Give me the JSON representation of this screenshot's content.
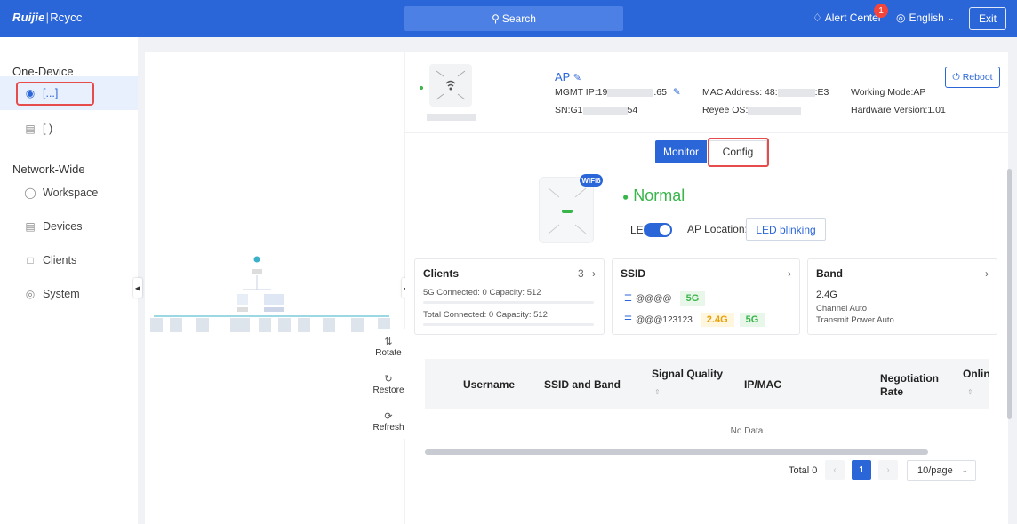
{
  "header": {
    "logo_brand": "Ruijie",
    "logo_sub": "Rcycc",
    "search_label": "Search",
    "alert_label": "Alert Center",
    "alert_count": "1",
    "language": "English",
    "exit_label": "Exit"
  },
  "sidebar": {
    "one_device_label": "One-Device",
    "device_item_1": "[...]",
    "device_item_2": "[ )",
    "network_wide_label": "Network-Wide",
    "items": [
      {
        "label": "Workspace",
        "icon": "workspace-icon"
      },
      {
        "label": "Devices",
        "icon": "devices-icon"
      },
      {
        "label": "Clients",
        "icon": "clients-icon"
      },
      {
        "label": "System",
        "icon": "system-icon"
      }
    ]
  },
  "topology_controls": {
    "rotate": "Rotate",
    "restore": "Restore",
    "refresh": "Refresh"
  },
  "device": {
    "title": "AP",
    "mgmt_ip_label": "MGMT IP:19",
    "mgmt_ip_suffix": ".65",
    "sn_label": "SN:G1",
    "sn_suffix": "54",
    "mac_label": "MAC Address: 48:",
    "mac_suffix": ":E3",
    "os_label": "Reyee OS:",
    "working_mode": "Working Mode:AP",
    "hardware_version": "Hardware Version:1.01",
    "reboot_label": "Reboot"
  },
  "tabs": {
    "monitor": "Monitor",
    "config": "Config"
  },
  "status": {
    "wifi_badge": "WiFi6",
    "state": "Normal",
    "led_label": "LED:",
    "led_on": true,
    "ap_location_label": "AP Location:",
    "led_blinking_button": "LED blinking"
  },
  "cards": {
    "clients": {
      "title": "Clients",
      "count": "3",
      "line1": "5G Connected: 0  Capacity: 512",
      "line2": "Total Connected: 0  Capacity: 512"
    },
    "ssid": {
      "title": "SSID",
      "rows": [
        {
          "name": "@@@@",
          "bands": [
            "5G"
          ]
        },
        {
          "name": "@@@123123",
          "bands": [
            "2.4G",
            "5G"
          ]
        }
      ]
    },
    "band": {
      "title": "Band",
      "band": "2.4G",
      "channel": "Channel Auto",
      "power": "Transmit Power Auto"
    }
  },
  "table": {
    "columns": [
      "Username",
      "SSID and Band",
      "Signal Quality",
      "IP/MAC",
      "Negotiation Rate",
      "Onlin"
    ],
    "empty_text": "No Data"
  },
  "pagination": {
    "total_label": "Total 0",
    "current_page": "1",
    "per_page": "10/page"
  },
  "colors": {
    "primary": "#2b66d9",
    "success": "#39b54a",
    "highlight": "#e74c4c"
  }
}
